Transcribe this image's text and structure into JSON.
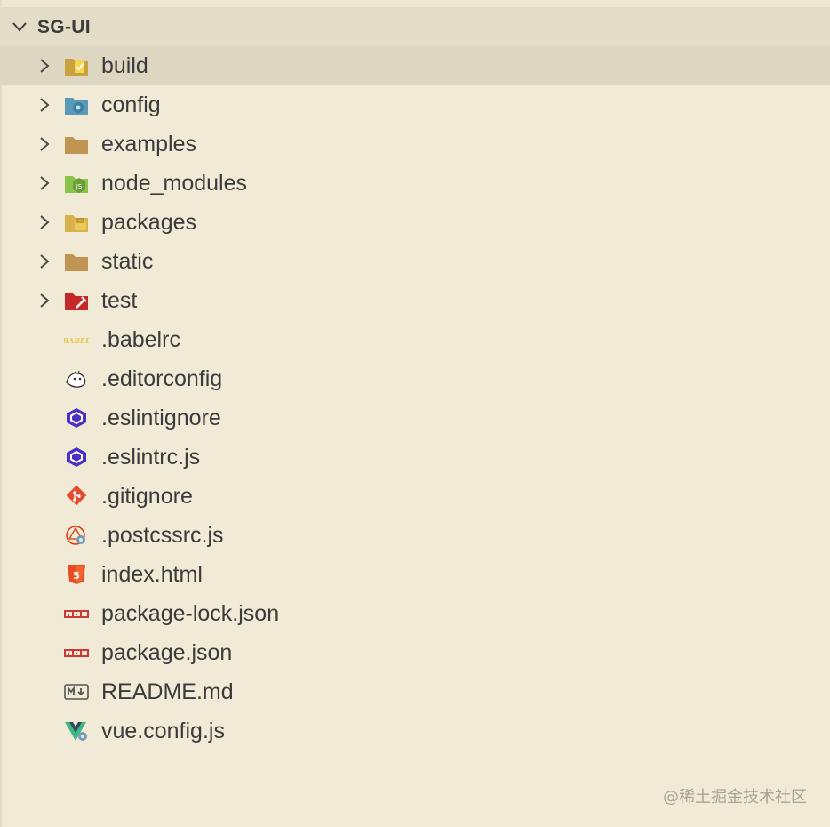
{
  "explorer": {
    "project_name": "SG-UI",
    "folders": [
      {
        "label": "build",
        "icon": "build-folder-icon"
      },
      {
        "label": "config",
        "icon": "config-folder-icon"
      },
      {
        "label": "examples",
        "icon": "folder-icon"
      },
      {
        "label": "node_modules",
        "icon": "node-modules-folder-icon"
      },
      {
        "label": "packages",
        "icon": "packages-folder-icon"
      },
      {
        "label": "static",
        "icon": "folder-icon"
      },
      {
        "label": "test",
        "icon": "test-folder-icon"
      }
    ],
    "files": [
      {
        "label": ".babelrc",
        "icon": "babel-icon"
      },
      {
        "label": ".editorconfig",
        "icon": "editorconfig-icon"
      },
      {
        "label": ".eslintignore",
        "icon": "eslint-icon"
      },
      {
        "label": ".eslintrc.js",
        "icon": "eslint-icon"
      },
      {
        "label": ".gitignore",
        "icon": "git-icon"
      },
      {
        "label": ".postcssrc.js",
        "icon": "postcss-icon"
      },
      {
        "label": "index.html",
        "icon": "html5-icon"
      },
      {
        "label": "package-lock.json",
        "icon": "npm-icon"
      },
      {
        "label": "package.json",
        "icon": "npm-icon"
      },
      {
        "label": "README.md",
        "icon": "markdown-icon"
      },
      {
        "label": "vue.config.js",
        "icon": "vue-icon"
      }
    ],
    "selected": "build"
  },
  "watermark": "@稀土掘金技术社区",
  "colors": {
    "background": "#f0ead6",
    "header": "#e3ddc8",
    "selected_row": "#ddd6c1",
    "text": "#3b3b3b"
  }
}
